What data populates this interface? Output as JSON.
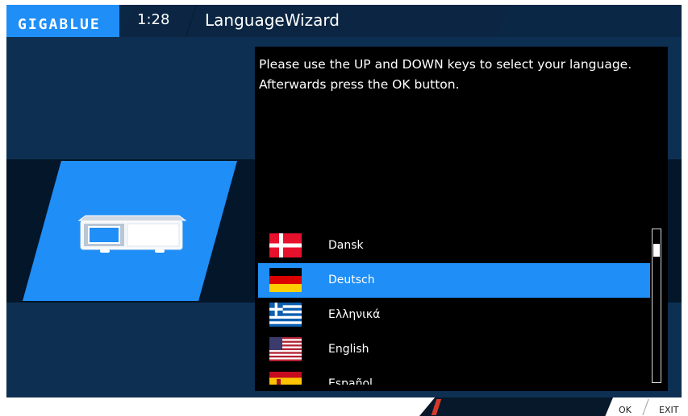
{
  "header": {
    "logo": "GIGABLUE",
    "time": "1:28",
    "title": "LanguageWizard"
  },
  "instructions": [
    "Please use the UP and DOWN keys to select your language.",
    "Afterwards press the OK button."
  ],
  "languages": [
    {
      "label": "Dansk",
      "flag": "denmark-flag"
    },
    {
      "label": "Deutsch",
      "flag": "germany-flag",
      "selected": true
    },
    {
      "label": "Ελληνικά",
      "flag": "greece-flag"
    },
    {
      "label": "English",
      "flag": "usa-flag"
    },
    {
      "label": "Español",
      "flag": "spain-flag"
    }
  ],
  "footer": {
    "ok_label": "OK",
    "exit_label": "EXIT"
  },
  "colors": {
    "accent": "#1f8ef6",
    "background": "#0d2f52",
    "panel": "#000000"
  },
  "icons": {
    "device": "set-top-box-receiver-icon"
  }
}
